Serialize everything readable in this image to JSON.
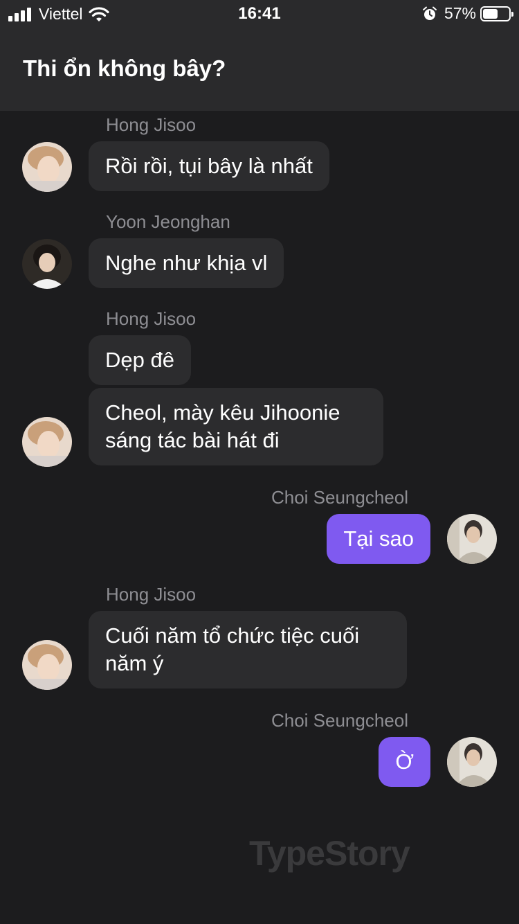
{
  "status_bar": {
    "carrier": "Viettel",
    "time": "16:41",
    "battery_percent": "57%",
    "battery_level": 0.57
  },
  "header": {
    "title": "Thi ổn không bây?"
  },
  "messages": [
    {
      "sender": "Hong Jisoo",
      "text": "Rồi rồi, tụi bây là nhất",
      "mine": false
    },
    {
      "sender": "Yoon Jeonghan",
      "text": "Nghe như khịa vl",
      "mine": false
    },
    {
      "sender": "Hong Jisoo",
      "text": "Dẹp đê",
      "mine": false
    },
    {
      "sender": "Hong Jisoo",
      "text": "Cheol, mày kêu Jihoonie sáng tác bài hát đi",
      "mine": false
    },
    {
      "sender": "Choi Seungcheol",
      "text": "Tại sao",
      "mine": true
    },
    {
      "sender": "Hong Jisoo",
      "text": "Cuối năm tổ chức tiệc cuối năm ý",
      "mine": false
    },
    {
      "sender": "Choi Seungcheol",
      "text": "Ờ",
      "mine": true
    }
  ],
  "watermark": "TypeStory",
  "colors": {
    "background": "#1c1c1e",
    "header": "#2a2a2c",
    "bubble_other": "#2c2c2e",
    "bubble_mine": "#7f5af0"
  }
}
